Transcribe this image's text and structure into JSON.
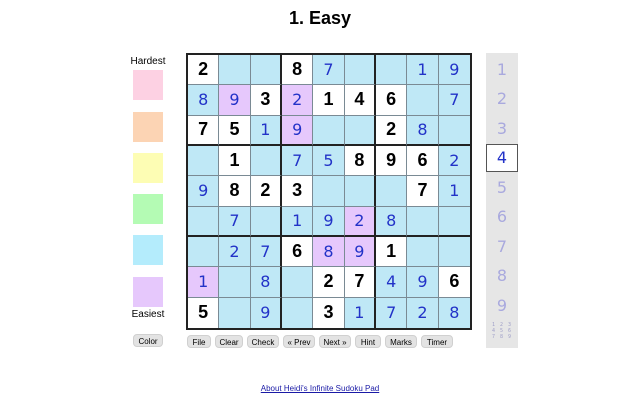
{
  "title": "1. Easy",
  "legend": {
    "top_label": "Hardest",
    "bottom_label": "Easiest",
    "colors": [
      "#fdd1e3",
      "#fcd4b4",
      "#fdfdb4",
      "#b4fbb4",
      "#b4ecfc",
      "#e6c8fc"
    ],
    "color_button": "Color"
  },
  "toolbar": {
    "buttons": [
      "File",
      "Clear",
      "Check",
      "« Prev",
      "Next »",
      "Hint",
      "Marks",
      "Timer"
    ]
  },
  "board": {
    "values": [
      [
        "2",
        "",
        "",
        "8",
        "7",
        "",
        "",
        "1",
        "9"
      ],
      [
        "8",
        "9",
        "3",
        "2",
        "1",
        "4",
        "6",
        "",
        "7"
      ],
      [
        "7",
        "5",
        "1",
        "9",
        "",
        "",
        "2",
        "8",
        ""
      ],
      [
        "",
        "1",
        "",
        "7",
        "5",
        "8",
        "9",
        "6",
        "2"
      ],
      [
        "9",
        "8",
        "2",
        "3",
        "",
        "",
        "",
        "7",
        "1"
      ],
      [
        "",
        "7",
        "",
        "1",
        "9",
        "2",
        "8",
        "",
        ""
      ],
      [
        "",
        "2",
        "7",
        "6",
        "8",
        "9",
        "1",
        "",
        ""
      ],
      [
        "1",
        "",
        "8",
        "",
        "2",
        "7",
        "4",
        "9",
        "6"
      ],
      [
        "5",
        "",
        "9",
        "",
        "3",
        "1",
        "7",
        "2",
        "8"
      ]
    ],
    "given": [
      [
        1,
        0,
        0,
        1,
        0,
        0,
        0,
        0,
        0
      ],
      [
        0,
        0,
        1,
        0,
        1,
        1,
        1,
        0,
        0
      ],
      [
        1,
        1,
        0,
        0,
        0,
        0,
        1,
        0,
        0
      ],
      [
        0,
        1,
        0,
        0,
        0,
        1,
        1,
        1,
        0
      ],
      [
        0,
        1,
        1,
        1,
        0,
        0,
        0,
        1,
        0
      ],
      [
        0,
        0,
        0,
        0,
        0,
        0,
        0,
        0,
        0
      ],
      [
        0,
        0,
        0,
        1,
        0,
        0,
        1,
        0,
        0
      ],
      [
        0,
        0,
        0,
        0,
        1,
        1,
        0,
        0,
        1
      ],
      [
        1,
        0,
        0,
        0,
        1,
        0,
        0,
        0,
        0
      ]
    ],
    "fills": [
      [
        "#ffffff",
        "#bfe8f6",
        "#bfe8f6",
        "#ffffff",
        "#bfe8f6",
        "#bfe8f6",
        "#bfe8f6",
        "#bfe8f6",
        "#bfe8f6"
      ],
      [
        "#bfe8f6",
        "#e6c8fc",
        "#ffffff",
        "#e6c8fc",
        "#ffffff",
        "#ffffff",
        "#ffffff",
        "#bfe8f6",
        "#bfe8f6"
      ],
      [
        "#ffffff",
        "#ffffff",
        "#bfe8f6",
        "#e6c8fc",
        "#bfe8f6",
        "#bfe8f6",
        "#ffffff",
        "#bfe8f6",
        "#bfe8f6"
      ],
      [
        "#bfe8f6",
        "#ffffff",
        "#bfe8f6",
        "#bfe8f6",
        "#bfe8f6",
        "#ffffff",
        "#ffffff",
        "#ffffff",
        "#bfe8f6"
      ],
      [
        "#bfe8f6",
        "#ffffff",
        "#ffffff",
        "#ffffff",
        "#bfe8f6",
        "#bfe8f6",
        "#bfe8f6",
        "#ffffff",
        "#bfe8f6"
      ],
      [
        "#bfe8f6",
        "#bfe8f6",
        "#bfe8f6",
        "#bfe8f6",
        "#bfe8f6",
        "#e6c8fc",
        "#bfe8f6",
        "#bfe8f6",
        "#bfe8f6"
      ],
      [
        "#bfe8f6",
        "#bfe8f6",
        "#bfe8f6",
        "#ffffff",
        "#e6c8fc",
        "#e6c8fc",
        "#ffffff",
        "#bfe8f6",
        "#bfe8f6"
      ],
      [
        "#e6c8fc",
        "#bfe8f6",
        "#bfe8f6",
        "#bfe8f6",
        "#ffffff",
        "#ffffff",
        "#bfe8f6",
        "#bfe8f6",
        "#ffffff"
      ],
      [
        "#ffffff",
        "#bfe8f6",
        "#bfe8f6",
        "#bfe8f6",
        "#ffffff",
        "#bfe8f6",
        "#bfe8f6",
        "#bfe8f6",
        "#bfe8f6"
      ]
    ]
  },
  "palette": {
    "numbers": [
      "1",
      "2",
      "3",
      "4",
      "5",
      "6",
      "7",
      "8",
      "9"
    ],
    "selected": "4",
    "marks_digits": "1 2 3 4 5 6 7 8 9"
  },
  "footer": {
    "about_link": "About Heidi's Infinite Sudoku Pad"
  }
}
